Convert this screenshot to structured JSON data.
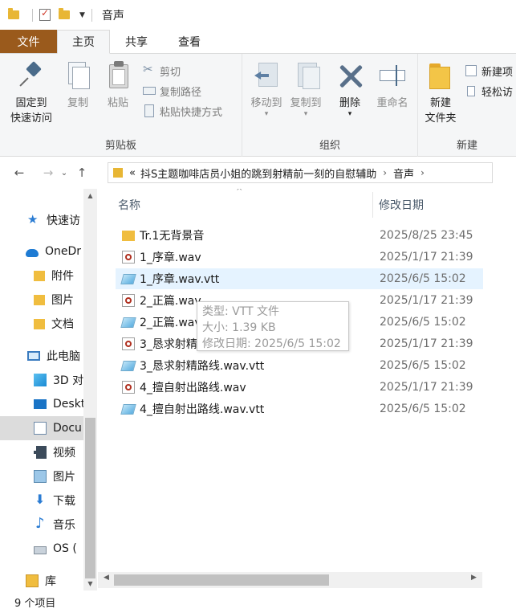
{
  "window": {
    "title": "音声"
  },
  "ribbon_tabs": [
    "文件",
    "主页",
    "共享",
    "查看"
  ],
  "clipboard": {
    "pin_line1": "固定到",
    "pin_line2": "快速访问",
    "copy": "复制",
    "paste": "粘贴",
    "cut": "剪切",
    "copy_path": "复制路径",
    "paste_shortcut": "粘贴快捷方式",
    "label": "剪贴板"
  },
  "organize": {
    "move_to": "移动到",
    "copy_to": "复制到",
    "delete": "删除",
    "rename": "重命名",
    "label": "组织"
  },
  "new": {
    "new_folder_line1": "新建",
    "new_folder_line2": "文件夹",
    "new_item": "新建项",
    "easy_access": "轻松访",
    "label": "新建"
  },
  "address": {
    "prefix": "«",
    "segments": [
      "抖S主题咖啡店员小姐的跳到射精前一刻的自慰辅助",
      "音声"
    ]
  },
  "nav": [
    {
      "label": "快速访",
      "icon": "star-icon"
    },
    {
      "label": "OneDr",
      "icon": "cloud-icon"
    },
    {
      "label": "附件",
      "icon": "folder-icon"
    },
    {
      "label": "图片",
      "icon": "folder-icon"
    },
    {
      "label": "文档",
      "icon": "folder-icon"
    },
    {
      "label": "此电脑",
      "icon": "computer-icon"
    },
    {
      "label": "3D 对",
      "icon": "cube-icon"
    },
    {
      "label": "Deskt",
      "icon": "desktop-icon"
    },
    {
      "label": "Docu",
      "icon": "documents-icon"
    },
    {
      "label": "视频",
      "icon": "video-icon"
    },
    {
      "label": "图片",
      "icon": "picture-icon"
    },
    {
      "label": "下载",
      "icon": "download-icon"
    },
    {
      "label": "音乐",
      "icon": "music-icon"
    },
    {
      "label": "OS (",
      "icon": "drive-icon"
    },
    {
      "label": "库",
      "icon": "library-icon"
    }
  ],
  "columns": {
    "name": "名称",
    "date": "修改日期"
  },
  "files": [
    {
      "name": "Tr.1无背景音",
      "date": "2025/8/25 23:45",
      "type": "folder"
    },
    {
      "name": "1_序章.wav",
      "date": "2025/1/17 21:39",
      "type": "wav"
    },
    {
      "name": "1_序章.wav.vtt",
      "date": "2025/6/5 15:02",
      "type": "vtt"
    },
    {
      "name": "2_正篇.wav",
      "date": "2025/1/17 21:39",
      "type": "wav"
    },
    {
      "name": "2_正篇.wav.vtt",
      "date": "2025/6/5 15:02",
      "type": "vtt"
    },
    {
      "name": "3_恳求射精路线.wav",
      "date": "2025/1/17 21:39",
      "type": "wav"
    },
    {
      "name": "3_恳求射精路线.wav.vtt",
      "date": "2025/6/5 15:02",
      "type": "vtt"
    },
    {
      "name": "4_擅自射出路线.wav",
      "date": "2025/1/17 21:39",
      "type": "wav"
    },
    {
      "name": "4_擅自射出路线.wav.vtt",
      "date": "2025/6/5 15:02",
      "type": "vtt"
    }
  ],
  "tooltip": {
    "type": "类型: VTT 文件",
    "size": "大小: 1.39 KB",
    "modified": "修改日期: 2025/6/5 15:02"
  },
  "status": {
    "count": "9 个项目"
  },
  "colors": {
    "file_tab": "#9a5a1c",
    "hover_row": "#e5f3ff",
    "folder": "#f0bd3f"
  }
}
